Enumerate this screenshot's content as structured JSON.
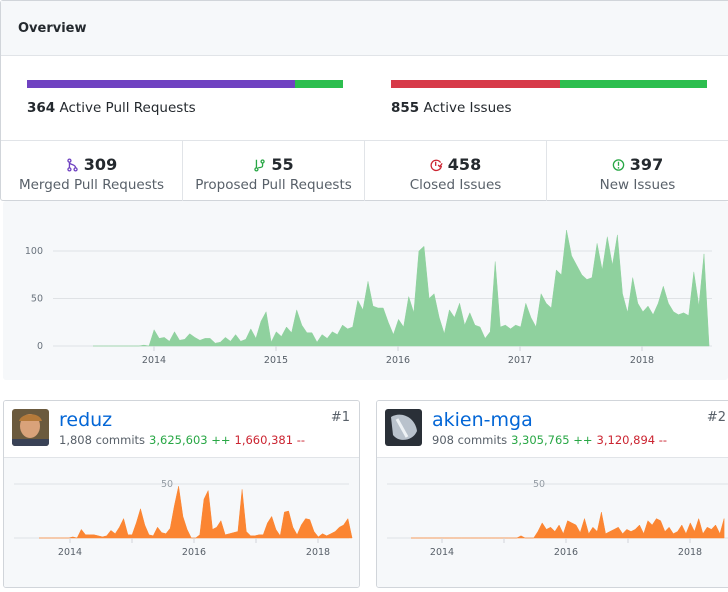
{
  "overview": {
    "title": "Overview",
    "pull_requests": {
      "count": "364",
      "label": "Active Pull Requests",
      "merged": 309,
      "proposed": 55
    },
    "issues": {
      "count": "855",
      "label": "Active Issues",
      "closed": 458,
      "new": 397
    },
    "stats": [
      {
        "icon": "git-merge-icon",
        "value": "309",
        "label": "Merged Pull Requests",
        "color": "#6f42c1"
      },
      {
        "icon": "git-pull-request-icon",
        "value": "55",
        "label": "Proposed Pull Requests",
        "color": "#28a745"
      },
      {
        "icon": "issue-closed-icon",
        "value": "458",
        "label": "Closed Issues",
        "color": "#cb2431"
      },
      {
        "icon": "issue-opened-icon",
        "value": "397",
        "label": "New Issues",
        "color": "#28a745"
      }
    ],
    "colors": {
      "merged": "#6f42c1",
      "proposed": "#2cbe4e",
      "closed": "#d73a49",
      "open": "#2cbe4e"
    }
  },
  "chart_data": [
    {
      "type": "area",
      "title": "Commits over time",
      "x_start": 2013.5,
      "x_end": 2018.55,
      "xticks": [
        "2014",
        "2015",
        "2016",
        "2017",
        "2018"
      ],
      "yticks": [
        "0",
        "50",
        "100"
      ],
      "ylim": [
        0,
        130
      ],
      "color": "#8fd19e",
      "values": [
        0,
        0,
        0,
        0,
        0,
        0,
        0,
        0,
        0,
        0,
        1,
        0,
        17,
        8,
        9,
        5,
        15,
        6,
        7,
        13,
        9,
        6,
        8,
        8,
        3,
        4,
        9,
        5,
        12,
        5,
        7,
        18,
        8,
        26,
        36,
        4,
        15,
        10,
        20,
        14,
        38,
        22,
        14,
        14,
        4,
        12,
        8,
        15,
        12,
        22,
        18,
        20,
        48,
        38,
        68,
        42,
        40,
        40,
        25,
        12,
        28,
        20,
        52,
        35,
        100,
        105,
        50,
        55,
        30,
        13,
        38,
        30,
        45,
        22,
        35,
        22,
        20,
        8,
        15,
        89,
        20,
        22,
        18,
        22,
        20,
        45,
        30,
        20,
        55,
        45,
        40,
        80,
        75,
        122,
        95,
        85,
        75,
        70,
        72,
        108,
        80,
        115,
        85,
        117,
        55,
        35,
        72,
        45,
        36,
        42,
        33,
        45,
        63,
        45,
        36,
        33,
        35,
        32,
        78,
        42,
        97,
        0
      ]
    },
    {
      "type": "area",
      "title": "reduz commits",
      "x_start": 2013.5,
      "x_end": 2018.55,
      "xticks": [
        "2014",
        "2016",
        "2018"
      ],
      "yticks": [
        "50"
      ],
      "ylim": [
        0,
        50
      ],
      "color": "#fb8532",
      "values": [
        0,
        0,
        0,
        0,
        0,
        0,
        0,
        0,
        1,
        0,
        8,
        3,
        3,
        3,
        2,
        1,
        2,
        7,
        4,
        10,
        18,
        3,
        3,
        14,
        27,
        12,
        3,
        2,
        10,
        5,
        4,
        9,
        30,
        48,
        20,
        8,
        0,
        0,
        3,
        36,
        44,
        8,
        10,
        16,
        3,
        4,
        5,
        6,
        45,
        6,
        2,
        2,
        3,
        3,
        14,
        20,
        8,
        2,
        24,
        25,
        10,
        3,
        12,
        18,
        17,
        6,
        1,
        4,
        2,
        4,
        6,
        10,
        12,
        18,
        0
      ]
    },
    {
      "type": "area",
      "title": "akien-mga commits",
      "x_start": 2013.5,
      "x_end": 2018.55,
      "xticks": [
        "2014",
        "2016",
        "2018"
      ],
      "yticks": [
        "50"
      ],
      "ylim": [
        0,
        50
      ],
      "color": "#fb8532",
      "values": [
        0,
        0,
        0,
        0,
        0,
        0,
        0,
        0,
        0,
        0,
        0,
        0,
        0,
        0,
        0,
        0,
        0,
        0,
        0,
        0,
        0,
        0,
        0,
        0,
        0,
        0,
        2,
        0,
        0,
        0,
        6,
        14,
        8,
        10,
        6,
        12,
        4,
        16,
        14,
        12,
        5,
        18,
        4,
        10,
        6,
        24,
        4,
        6,
        8,
        10,
        4,
        8,
        6,
        8,
        12,
        4,
        16,
        12,
        18,
        16,
        6,
        10,
        4,
        6,
        12,
        4,
        14,
        6,
        18,
        4,
        10,
        8,
        12,
        4,
        18
      ]
    }
  ],
  "contributors": [
    {
      "name": "reduz",
      "rank": "#1",
      "commits": "1,808 commits",
      "additions": "3,625,603 ++",
      "deletions": "1,660,381 --"
    },
    {
      "name": "akien-mga",
      "rank": "#2",
      "commits": "908 commits",
      "additions": "3,305,765 ++",
      "deletions": "3,120,894 --"
    }
  ]
}
